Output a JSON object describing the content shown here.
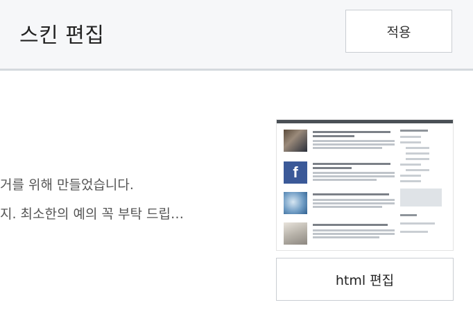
{
  "header": {
    "title": "스킨 편집",
    "apply_label": "적용"
  },
  "description": {
    "line1": "거를 위해 만들었습니다.",
    "line2": "지. 최소한의 예의 꼭 부탁 드립…"
  },
  "skin_preview": {
    "edit_html_label": "html 편집"
  }
}
